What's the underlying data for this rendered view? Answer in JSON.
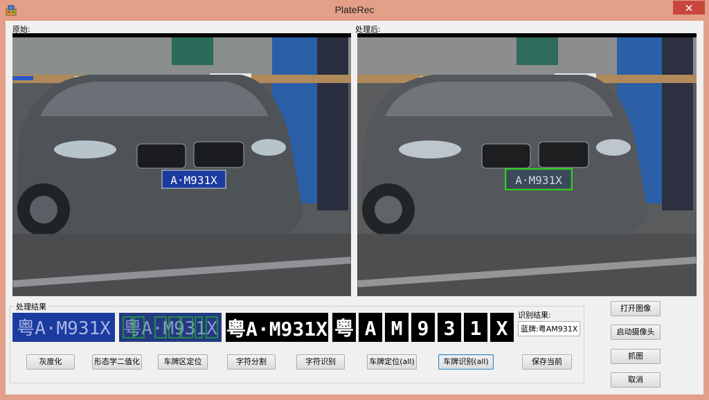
{
  "window": {
    "title": "PlateRec",
    "close_glyph": "✕",
    "app_icon": "app-icon"
  },
  "panels": {
    "original_label": "原始:",
    "processed_label": "处理后:"
  },
  "plate": {
    "text": "粤A·M931X",
    "short": "A·M931X"
  },
  "group": {
    "label": "处理结果"
  },
  "result": {
    "label": "识别结果:",
    "value": "蓝牌:粤AM931X"
  },
  "buttons": {
    "gray": "灰度化",
    "morph": "形态学二值化",
    "locate_region": "车牌区定位",
    "split_chars": "字符分割",
    "recognize_chars": "字符识别",
    "locate_all": "车牌定位(all)",
    "recognize_all": "车牌识别(all)",
    "save": "保存当前",
    "open_image": "打开图像",
    "start_camera": "启动摄像头",
    "capture": "抓图",
    "cancel": "取消"
  },
  "segmented_chars": [
    "粤",
    "A",
    "M",
    "9",
    "3",
    "1",
    "X"
  ],
  "colors": {
    "title_bg": "#e39f88",
    "close_btn": "#c7473d",
    "plate_blue": "#1b3b9e",
    "detect_box": "#27d21f"
  }
}
